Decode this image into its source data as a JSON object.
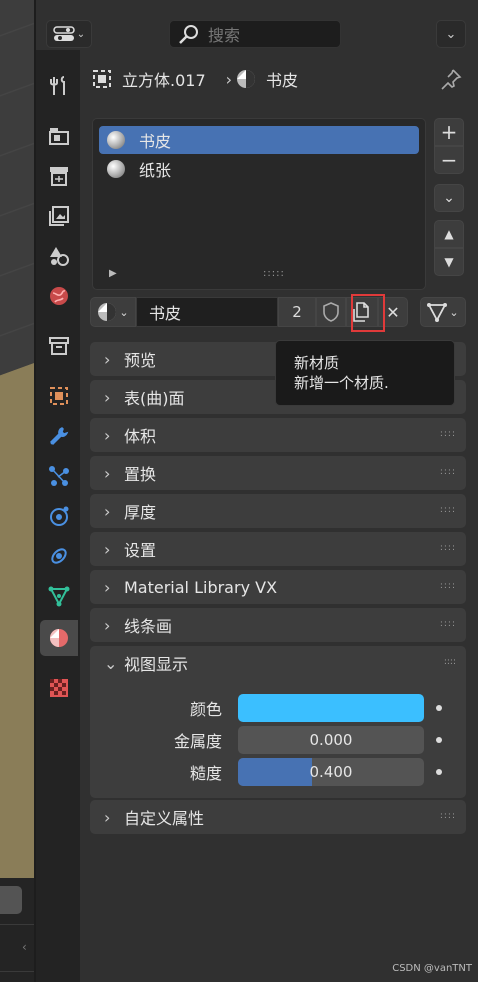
{
  "search": {
    "placeholder": "搜索"
  },
  "breadcrumb": {
    "object": "立方体.017",
    "material": "书皮"
  },
  "slots": [
    {
      "label": "书皮",
      "selected": true
    },
    {
      "label": "纸张",
      "selected": false
    }
  ],
  "material": {
    "name": "书皮",
    "users": "2"
  },
  "tooltip": {
    "title": "新材质",
    "description": "新增一个材质."
  },
  "panels": [
    {
      "label": "预览"
    },
    {
      "label": "表(曲)面"
    },
    {
      "label": "体积"
    },
    {
      "label": "置换"
    },
    {
      "label": "厚度"
    },
    {
      "label": "设置"
    },
    {
      "label": "Material Library VX"
    },
    {
      "label": "线条画"
    }
  ],
  "viewport_display": {
    "title": "视图显示",
    "color_label": "颜色",
    "color_value": "#3bbfff",
    "metallic_label": "金属度",
    "metallic_value": "0.000",
    "roughness_label": "糙度",
    "roughness_value": "0.400",
    "roughness_fraction": 0.4
  },
  "custom_props": {
    "label": "自定义属性"
  },
  "colors": {
    "accent": "#4772b3",
    "highlight": "#e03a3a"
  },
  "watermark": "CSDN @vanTNT"
}
